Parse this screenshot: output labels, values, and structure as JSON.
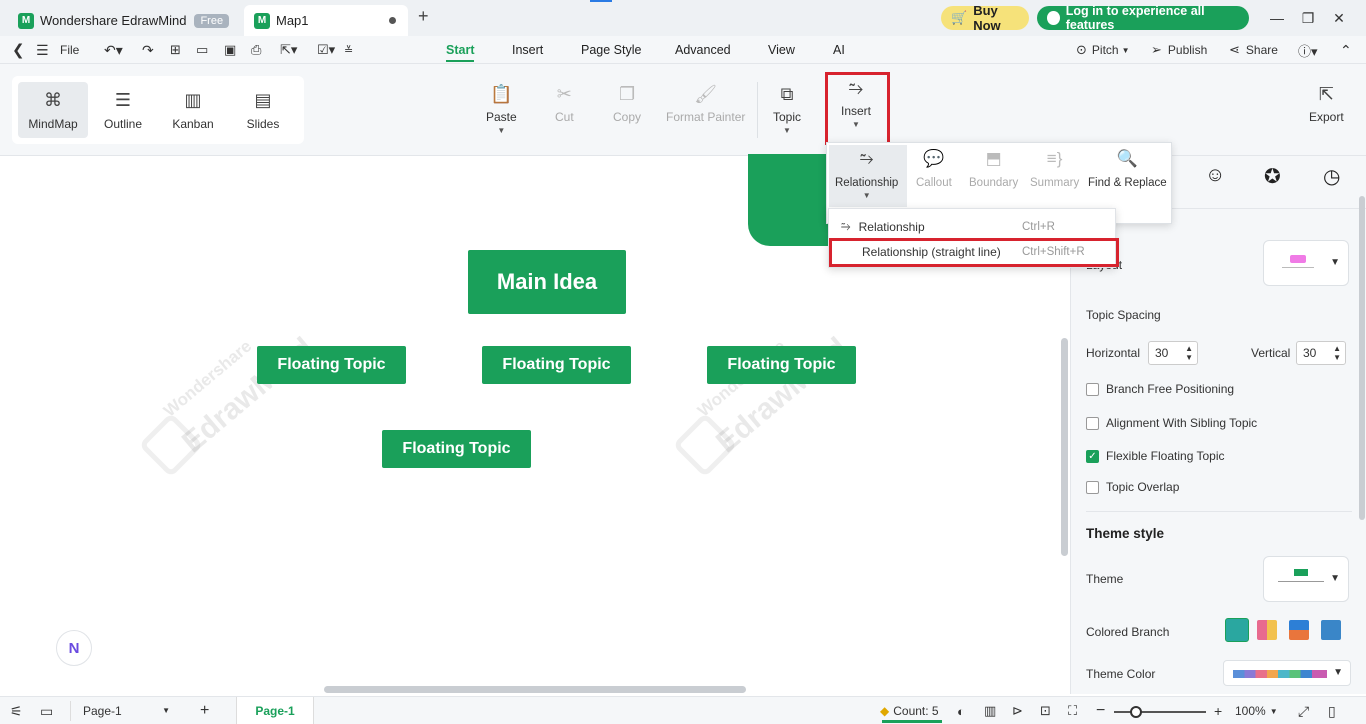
{
  "titlebar": {
    "app_tab": {
      "logo": "M",
      "title": "Wondershare EdrawMind",
      "badge": "Free"
    },
    "doc_tab": {
      "logo": "M",
      "title": "Map1"
    },
    "new_tab": "+",
    "buy_now": "Buy Now",
    "login": "Log in to experience all features",
    "window": {
      "minimize": "—",
      "restore": "❐",
      "close": "✕"
    }
  },
  "menubar": {
    "file": "File",
    "tabs": [
      "Start",
      "Insert",
      "Page Style",
      "Advanced",
      "View",
      "AI"
    ],
    "active_tab": "Start",
    "pitch": "Pitch",
    "publish": "Publish",
    "share": "Share"
  },
  "ribbon": {
    "views": [
      {
        "label": "MindMap",
        "icon": "mindmap-icon",
        "glyph": "⌘"
      },
      {
        "label": "Outline",
        "icon": "outline-icon",
        "glyph": "☰"
      },
      {
        "label": "Kanban",
        "icon": "kanban-icon",
        "glyph": "▥"
      },
      {
        "label": "Slides",
        "icon": "slides-icon",
        "glyph": "▤"
      }
    ],
    "paste": "Paste",
    "cut": "Cut",
    "copy": "Copy",
    "format_painter": "Format Painter",
    "topic": "Topic",
    "insert": "Insert",
    "export": "Export"
  },
  "insert_dropdown": {
    "relationship": "Relationship",
    "callout": "Callout",
    "boundary": "Boundary",
    "summary": "Summary",
    "find_replace": "Find & Replace"
  },
  "relationship_menu": {
    "items": [
      {
        "label": "Relationship",
        "shortcut": "Ctrl+R"
      },
      {
        "label": "Relationship (straight line)",
        "shortcut": "Ctrl+Shift+R"
      }
    ]
  },
  "canvas": {
    "main_idea": "Main Idea",
    "floating_topics": [
      "Floating Topic",
      "Floating Topic",
      "Floating Topic",
      "Floating Topic"
    ],
    "watermark_line1": "Wondershare",
    "watermark_line2": "EdrawMind"
  },
  "right_panel": {
    "layout_label": "Layout",
    "topic_spacing": "Topic Spacing",
    "horizontal_label": "Horizontal",
    "horizontal_value": "30",
    "vertical_label": "Vertical",
    "vertical_value": "30",
    "branch_free": "Branch Free Positioning",
    "alignment_sibling": "Alignment With Sibling Topic",
    "flexible_floating": "Flexible Floating Topic",
    "topic_overlap": "Topic Overlap",
    "theme_style": "Theme style",
    "theme_label": "Theme",
    "colored_branch": "Colored Branch",
    "theme_color": "Theme Color"
  },
  "statusbar": {
    "page_select": "Page-1",
    "page_tab": "Page-1",
    "count": "Count: 5",
    "zoom": "100%"
  },
  "colors": {
    "accent": "#1aa05a",
    "highlight_box": "#d7232e",
    "buy_now_bg": "#f6e27a"
  }
}
